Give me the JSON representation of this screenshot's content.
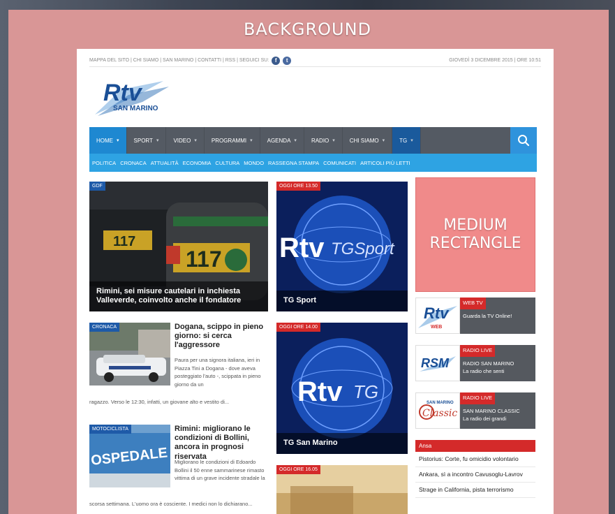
{
  "background": {
    "label": "BACKGROUND"
  },
  "topbar": {
    "links": "MAPPA DEL SITO | CHI SIAMO | SAN MARINO | CONTATTI | RSS | SEGUICI SU:",
    "date": "GIOVEDÌ 3 DICEMBRE 2015 | ORE 10:51",
    "social": [
      "f",
      "t"
    ]
  },
  "logo": {
    "brand": "Rtv",
    "sub": "SAN MARINO"
  },
  "mainnav": {
    "items": [
      "HOME",
      "SPORT",
      "VIDEO",
      "PROGRAMMI",
      "AGENDA",
      "RADIO",
      "CHI SIAMO",
      "TG"
    ],
    "icon": "search-icon"
  },
  "subnav": [
    "POLITICA",
    "CRONACA",
    "ATTUALITÀ",
    "ECONOMIA",
    "CULTURA",
    "MONDO",
    "RASSEGNA STAMPA",
    "COMUNICATI",
    "ARTICOLI PIÙ LETTI"
  ],
  "featured": {
    "tag": "GDF",
    "title": "Rimini, sei misure cautelari in inchiesta Valleverde, coinvolto anche il fondatore",
    "plate": "117"
  },
  "tg_cards": [
    {
      "tag": "OGGI ORE 13.50",
      "caption": "TG Sport",
      "logo": "Rtv",
      "logo2": "TGSport"
    },
    {
      "tag": "OGGI ORE 14.00",
      "caption": "TG San Marino",
      "logo": "Rtv",
      "logo2": "TG"
    },
    {
      "tag": "OGGI ORE 16.05"
    }
  ],
  "news": [
    {
      "tag": "CRONACA",
      "title": "Dogana, scippo in pieno giorno: si cerca l'aggressore",
      "body_side": "Paura per una signora italiana, ieri in Piazza Tini a Dogana - dove aveva posteggiato l'auto -, scippata in pieno giorno da un",
      "body_full": "ragazzo. Verso le 12:30, infatti, un giovane alto e vestito di..."
    },
    {
      "tag": "MOTOCICLISTA",
      "title": "Rimini: migliorano le condizioni di Bollini, ancora in prognosi riservata",
      "body_side": "Migliorano le condizioni di Edoardo Bollini il 50 enne sammarinese rimasto vittima di un grave incidente stradale la",
      "body_full": "scorsa settimana. L'uomo ora è cosciente. I medici non lo dichiarano...",
      "sign": "OSPEDALE DI STATO"
    }
  ],
  "ad": {
    "line1": "MEDIUM",
    "line2": "RECTANGLE"
  },
  "widgets": [
    {
      "label": "WEB TV",
      "line1": "Guarda la TV Online!",
      "line2": "",
      "logo": "Rtv",
      "logo_sub": "WEB"
    },
    {
      "label": "RADIO LIVE",
      "line1": "RADIO SAN MARINO",
      "line2": "La radio che senti",
      "logo": "RSM"
    },
    {
      "label": "RADIO LIVE",
      "line1": "SAN MARINO CLASSIC",
      "line2": "La radio dei grandi",
      "logo": "Classic",
      "logo_sub": "SAN MARINO"
    }
  ],
  "ansa": {
    "head": "Ansa",
    "items": [
      "Pistorius: Corte, fu omicidio volontario",
      "Ankara, sì a incontro Cavusoglu-Lavrov",
      "Strage in California, pista terrorismo"
    ]
  },
  "colors": {
    "nav": "#545a63",
    "active": "#1e88d1",
    "subnav": "#2ea3e3",
    "accent_red": "#d42a2a",
    "ad": "#f08a8a",
    "backdrop": "#d99696"
  }
}
